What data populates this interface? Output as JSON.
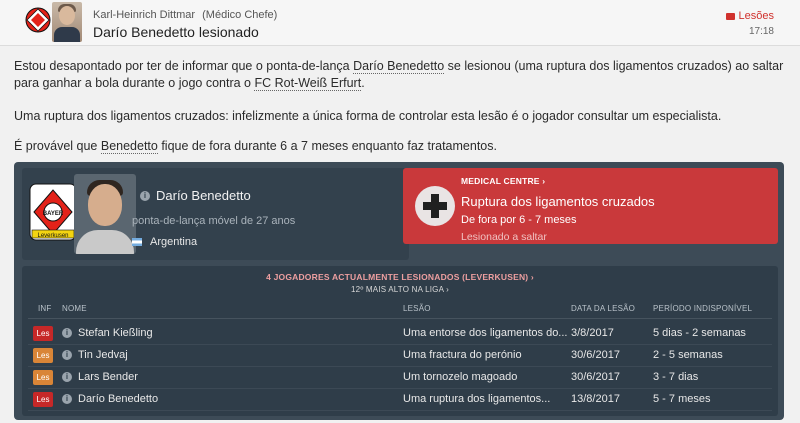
{
  "header": {
    "sender_name": "Karl-Heinrich Dittmar",
    "sender_role": "(Médico Chefe)",
    "subject": "Darío Benedetto lesionado",
    "tag": "Lesões",
    "time": "17:18"
  },
  "message": {
    "p1_a": "Estou desapontado por ter de informar que o ponta-de-lança ",
    "p1_player": "Darío Benedetto",
    "p1_b": " se lesionou (uma ruptura dos ligamentos cruzados) ao saltar para ganhar a bola durante o jogo contra o ",
    "p1_club": "FC Rot-Weiß Erfurt",
    "p1_c": ".",
    "p2": "Uma ruptura dos ligamentos cruzados: infelizmente a única forma de controlar esta lesão é o jogador consultar um especialista.",
    "p3_a": "É provável que ",
    "p3_player": "Benedetto",
    "p3_b": " fique de fora durante 6 a 7 meses enquanto faz tratamentos."
  },
  "player": {
    "name": "Darío Benedetto",
    "position": "ponta-de-lança móvel de 27 anos",
    "nationality": "Argentina",
    "club_badge_text": "Leverkusen"
  },
  "injury": {
    "medical_centre": "MEDICAL CENTRE ›",
    "title": "Ruptura dos ligamentos cruzados",
    "duration": "De fora por 6 - 7 meses",
    "cause": "Lesionado a saltar"
  },
  "injury_table": {
    "summary": "4 JOGADORES ACTUALMENTE LESIONADOS (LEVERKUSEN) ›",
    "rank": "12º MAIS ALTO NA LIGA ›",
    "columns": {
      "inf": "INF",
      "name": "NOME",
      "injury": "LESÃO",
      "date": "DATA DA LESÃO",
      "period": "PERÍODO INDISPONÍVEL"
    },
    "rows": [
      {
        "badge": "Les",
        "badge_color": "#c62828",
        "name": "Stefan Kießling",
        "injury": "Uma entorse dos ligamentos do...",
        "date": "3/8/2017",
        "period": "5 dias - 2 semanas"
      },
      {
        "badge": "Les",
        "badge_color": "#d98537",
        "name": "Tin Jedvaj",
        "injury": "Uma fractura do perónio",
        "date": "30/6/2017",
        "period": "2 - 5 semanas"
      },
      {
        "badge": "Les",
        "badge_color": "#d98537",
        "name": "Lars Bender",
        "injury": "Um tornozelo magoado",
        "date": "30/6/2017",
        "period": "3 - 7 dias"
      },
      {
        "badge": "Les",
        "badge_color": "#c62828",
        "name": "Darío Benedetto",
        "injury": "Uma ruptura dos ligamentos...",
        "date": "13/8/2017",
        "period": "5 - 7 meses"
      }
    ]
  }
}
